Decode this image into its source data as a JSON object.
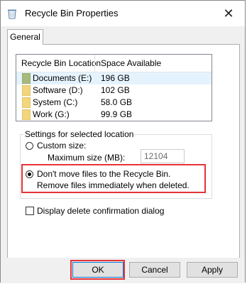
{
  "window": {
    "title": "Recycle Bin Properties",
    "close_glyph": "✕"
  },
  "tabs": [
    {
      "label": "General",
      "active": true
    }
  ],
  "locations": {
    "headers": [
      "Recycle Bin Location",
      "Space Available"
    ],
    "rows": [
      {
        "name": "Documents (E:)",
        "space": "196 GB",
        "selected": true
      },
      {
        "name": "Software (D:)",
        "space": "102 GB",
        "selected": false
      },
      {
        "name": "System (C:)",
        "space": "58.0 GB",
        "selected": false
      },
      {
        "name": "Work (G:)",
        "space": "99.9 GB",
        "selected": false
      }
    ]
  },
  "settings": {
    "group_label": "Settings for selected location",
    "custom_size_label": "Custom size:",
    "custom_size_checked": false,
    "max_size_label": "Maximum size (MB):",
    "max_size_value": "12104",
    "dont_move_label": "Don't move files to the Recycle Bin. Remove files immediately when deleted.",
    "dont_move_checked": true
  },
  "confirm": {
    "label": "Display delete confirmation dialog",
    "checked": false
  },
  "buttons": {
    "ok": "OK",
    "cancel": "Cancel",
    "apply": "Apply"
  },
  "colors": {
    "highlight": "#e53238",
    "selection": "#e5f3ff",
    "folder": "#f2d57c",
    "folder_selected": "#a8b97d"
  },
  "icons": {
    "title": "recycle-bin-icon",
    "close": "close-icon",
    "folder": "folder-icon"
  }
}
